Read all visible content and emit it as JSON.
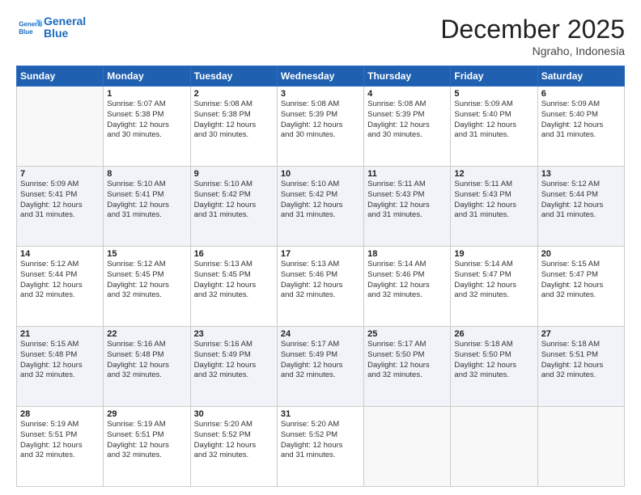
{
  "header": {
    "logo_line1": "General",
    "logo_line2": "Blue",
    "month": "December 2025",
    "location": "Ngraho, Indonesia"
  },
  "weekdays": [
    "Sunday",
    "Monday",
    "Tuesday",
    "Wednesday",
    "Thursday",
    "Friday",
    "Saturday"
  ],
  "rows": [
    [
      {
        "num": "",
        "info": ""
      },
      {
        "num": "1",
        "info": "Sunrise: 5:07 AM\nSunset: 5:38 PM\nDaylight: 12 hours\nand 30 minutes."
      },
      {
        "num": "2",
        "info": "Sunrise: 5:08 AM\nSunset: 5:38 PM\nDaylight: 12 hours\nand 30 minutes."
      },
      {
        "num": "3",
        "info": "Sunrise: 5:08 AM\nSunset: 5:39 PM\nDaylight: 12 hours\nand 30 minutes."
      },
      {
        "num": "4",
        "info": "Sunrise: 5:08 AM\nSunset: 5:39 PM\nDaylight: 12 hours\nand 30 minutes."
      },
      {
        "num": "5",
        "info": "Sunrise: 5:09 AM\nSunset: 5:40 PM\nDaylight: 12 hours\nand 31 minutes."
      },
      {
        "num": "6",
        "info": "Sunrise: 5:09 AM\nSunset: 5:40 PM\nDaylight: 12 hours\nand 31 minutes."
      }
    ],
    [
      {
        "num": "7",
        "info": "Sunrise: 5:09 AM\nSunset: 5:41 PM\nDaylight: 12 hours\nand 31 minutes."
      },
      {
        "num": "8",
        "info": "Sunrise: 5:10 AM\nSunset: 5:41 PM\nDaylight: 12 hours\nand 31 minutes."
      },
      {
        "num": "9",
        "info": "Sunrise: 5:10 AM\nSunset: 5:42 PM\nDaylight: 12 hours\nand 31 minutes."
      },
      {
        "num": "10",
        "info": "Sunrise: 5:10 AM\nSunset: 5:42 PM\nDaylight: 12 hours\nand 31 minutes."
      },
      {
        "num": "11",
        "info": "Sunrise: 5:11 AM\nSunset: 5:43 PM\nDaylight: 12 hours\nand 31 minutes."
      },
      {
        "num": "12",
        "info": "Sunrise: 5:11 AM\nSunset: 5:43 PM\nDaylight: 12 hours\nand 31 minutes."
      },
      {
        "num": "13",
        "info": "Sunrise: 5:12 AM\nSunset: 5:44 PM\nDaylight: 12 hours\nand 31 minutes."
      }
    ],
    [
      {
        "num": "14",
        "info": "Sunrise: 5:12 AM\nSunset: 5:44 PM\nDaylight: 12 hours\nand 32 minutes."
      },
      {
        "num": "15",
        "info": "Sunrise: 5:12 AM\nSunset: 5:45 PM\nDaylight: 12 hours\nand 32 minutes."
      },
      {
        "num": "16",
        "info": "Sunrise: 5:13 AM\nSunset: 5:45 PM\nDaylight: 12 hours\nand 32 minutes."
      },
      {
        "num": "17",
        "info": "Sunrise: 5:13 AM\nSunset: 5:46 PM\nDaylight: 12 hours\nand 32 minutes."
      },
      {
        "num": "18",
        "info": "Sunrise: 5:14 AM\nSunset: 5:46 PM\nDaylight: 12 hours\nand 32 minutes."
      },
      {
        "num": "19",
        "info": "Sunrise: 5:14 AM\nSunset: 5:47 PM\nDaylight: 12 hours\nand 32 minutes."
      },
      {
        "num": "20",
        "info": "Sunrise: 5:15 AM\nSunset: 5:47 PM\nDaylight: 12 hours\nand 32 minutes."
      }
    ],
    [
      {
        "num": "21",
        "info": "Sunrise: 5:15 AM\nSunset: 5:48 PM\nDaylight: 12 hours\nand 32 minutes."
      },
      {
        "num": "22",
        "info": "Sunrise: 5:16 AM\nSunset: 5:48 PM\nDaylight: 12 hours\nand 32 minutes."
      },
      {
        "num": "23",
        "info": "Sunrise: 5:16 AM\nSunset: 5:49 PM\nDaylight: 12 hours\nand 32 minutes."
      },
      {
        "num": "24",
        "info": "Sunrise: 5:17 AM\nSunset: 5:49 PM\nDaylight: 12 hours\nand 32 minutes."
      },
      {
        "num": "25",
        "info": "Sunrise: 5:17 AM\nSunset: 5:50 PM\nDaylight: 12 hours\nand 32 minutes."
      },
      {
        "num": "26",
        "info": "Sunrise: 5:18 AM\nSunset: 5:50 PM\nDaylight: 12 hours\nand 32 minutes."
      },
      {
        "num": "27",
        "info": "Sunrise: 5:18 AM\nSunset: 5:51 PM\nDaylight: 12 hours\nand 32 minutes."
      }
    ],
    [
      {
        "num": "28",
        "info": "Sunrise: 5:19 AM\nSunset: 5:51 PM\nDaylight: 12 hours\nand 32 minutes."
      },
      {
        "num": "29",
        "info": "Sunrise: 5:19 AM\nSunset: 5:51 PM\nDaylight: 12 hours\nand 32 minutes."
      },
      {
        "num": "30",
        "info": "Sunrise: 5:20 AM\nSunset: 5:52 PM\nDaylight: 12 hours\nand 32 minutes."
      },
      {
        "num": "31",
        "info": "Sunrise: 5:20 AM\nSunset: 5:52 PM\nDaylight: 12 hours\nand 31 minutes."
      },
      {
        "num": "",
        "info": ""
      },
      {
        "num": "",
        "info": ""
      },
      {
        "num": "",
        "info": ""
      }
    ]
  ],
  "row_shading": [
    false,
    true,
    false,
    true,
    false
  ]
}
